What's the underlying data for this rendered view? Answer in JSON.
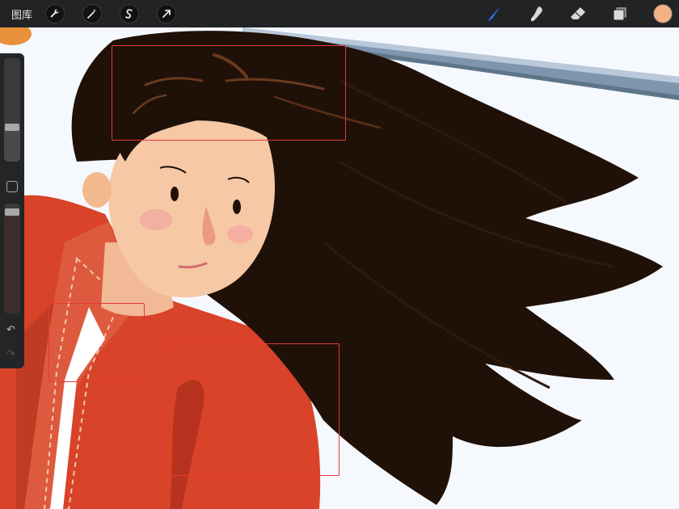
{
  "toolbar": {
    "gallery_label": "图库",
    "left_tools": [
      {
        "name": "actions",
        "icon": "wrench-icon"
      },
      {
        "name": "adjustments",
        "icon": "magic-wand-icon"
      },
      {
        "name": "selection",
        "icon": "selection-s-icon"
      },
      {
        "name": "transform",
        "icon": "arrow-cursor-icon"
      }
    ],
    "right_tools": [
      {
        "name": "brush",
        "icon": "brush-icon",
        "active": true,
        "color": "#2f6fe0"
      },
      {
        "name": "smudge",
        "icon": "smudge-icon",
        "active": false
      },
      {
        "name": "eraser",
        "icon": "eraser-icon",
        "active": false
      },
      {
        "name": "layers",
        "icon": "layers-icon",
        "active": false
      }
    ],
    "current_color": "#f4b183"
  },
  "sidebar": {
    "brush_size_level": 0.32,
    "opacity_level": 0.95,
    "modify_icon": "square-icon",
    "undo_icon": "undo-icon",
    "redo_icon": "redo-icon"
  },
  "canvas": {
    "background_color": "#f5f8fd",
    "hair_color": "#1f1108",
    "robe_color": "#d8432a",
    "skin_color": "#f6c8a5",
    "markup_color": "#e53a3a"
  }
}
